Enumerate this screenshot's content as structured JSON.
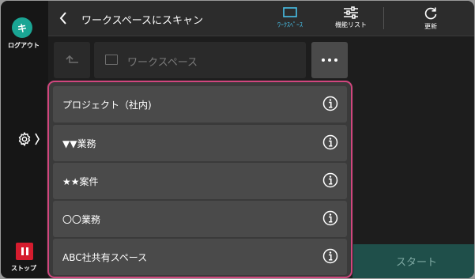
{
  "sidebar": {
    "avatar_letter": "キ",
    "logout_label": "ログアウト",
    "stop_label": "ストップ"
  },
  "header": {
    "title": "ワークスペースにスキャン",
    "workspace_tab_label": "ﾜｰｸｽﾍﾟｰｽ",
    "functions_label": "機能リスト",
    "refresh_label": "更新"
  },
  "path": {
    "current": "ワークスペース"
  },
  "dropdown": {
    "items": [
      {
        "label": "プロジェクト（社内)"
      },
      {
        "label": "▼▼業務"
      },
      {
        "label": "★★案件"
      },
      {
        "label": "〇〇業務"
      },
      {
        "label": "ABC社共有スペース"
      }
    ]
  },
  "footer": {
    "start_label": "スタート"
  },
  "colors": {
    "accent": "#48c0e8",
    "highlight_border": "#d1467e",
    "stop": "#d51c2e",
    "avatar": "#1aa594"
  }
}
